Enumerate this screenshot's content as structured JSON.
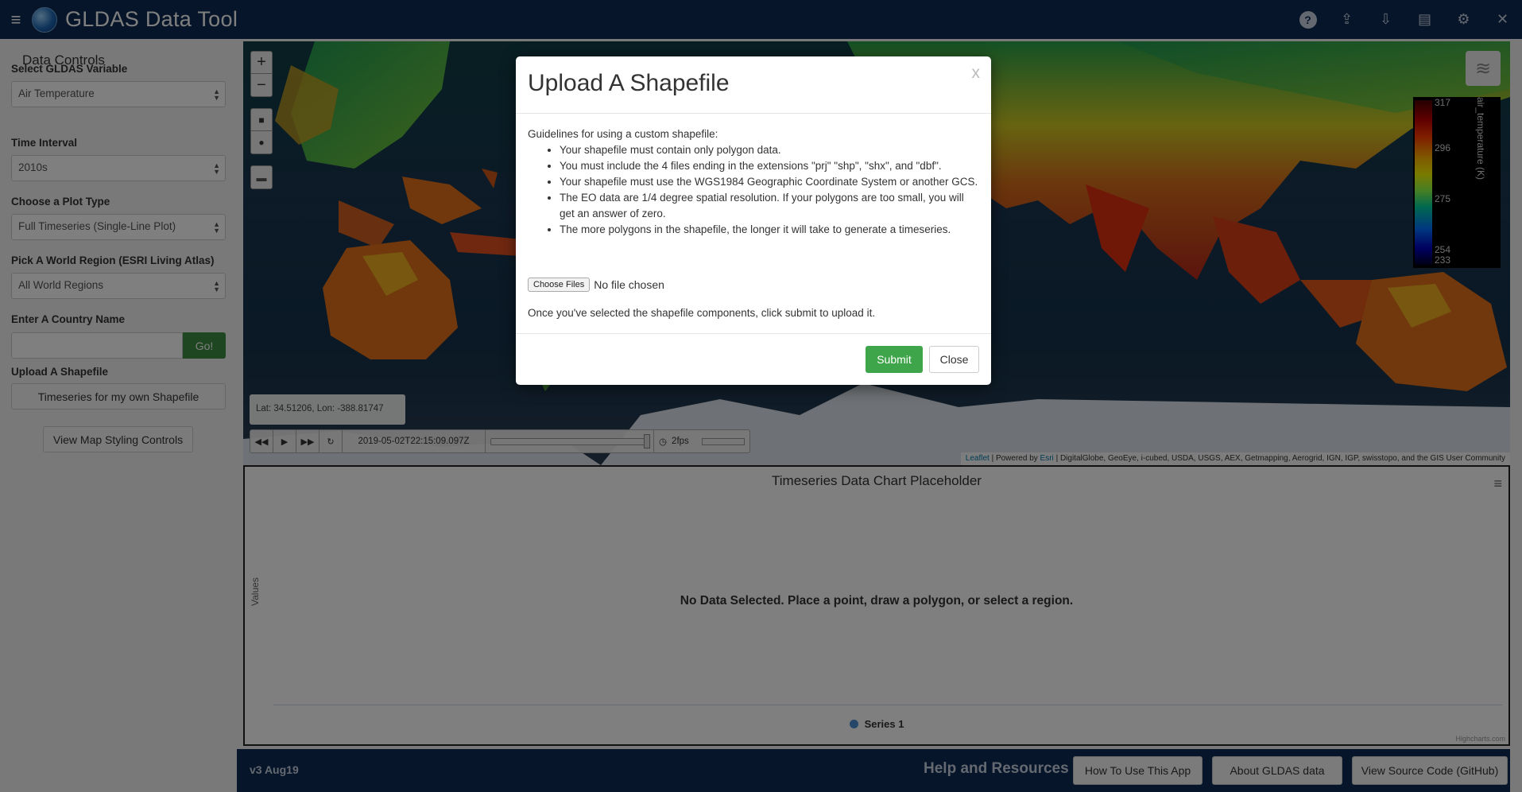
{
  "header": {
    "title": "GLDAS Data Tool",
    "menu_icon": "hamburger-icon",
    "tools": [
      {
        "icon": "help-icon",
        "glyph": "?"
      },
      {
        "icon": "upload-icon",
        "glyph": "⇪"
      },
      {
        "icon": "download-icon",
        "glyph": "⇩"
      },
      {
        "icon": "layers-stack-icon",
        "glyph": "▤"
      },
      {
        "icon": "gear-icon",
        "glyph": "⚙"
      },
      {
        "icon": "close-icon",
        "glyph": "✕"
      }
    ],
    "colors": {
      "background": "#0c2a52",
      "text": "#ffffff"
    }
  },
  "sidebar": {
    "title": "Data Controls",
    "variable": {
      "label": "Select GLDAS Variable",
      "value": "Air Temperature"
    },
    "interval": {
      "label": "Time Interval",
      "value": "2010s"
    },
    "plot_type": {
      "label": "Choose a Plot Type",
      "value": "Full Timeseries (Single-Line Plot)"
    },
    "region": {
      "label": "Pick A World Region (ESRI Living Atlas)",
      "value": "All World Regions"
    },
    "country": {
      "label": "Enter A Country Name",
      "value": "",
      "go_label": "Go!"
    },
    "shapefile": {
      "label": "Upload A Shapefile",
      "button": "Timeseries for my own Shapefile"
    },
    "styling_button": "View Map Styling Controls"
  },
  "map": {
    "zoom_in": "+",
    "zoom_out": "−",
    "legend": {
      "variable": "air_temperature (K)",
      "ticks": [
        "317",
        "296",
        "275",
        "254",
        "233"
      ]
    },
    "coordinates": "Lat: 34.51206, Lon: -388.81747",
    "time": "2019-05-02T22:15:09.097Z",
    "fps": "2fps",
    "attribution": {
      "leaflet": "Leaflet",
      "powered": "| Powered by",
      "esri": "Esri",
      "rest": "| DigitalGlobe, GeoEye, i-cubed, USDA, USGS, AEX, Getmapping, Aerogrid, IGN, IGP, swisstopo, and the GIS User Community"
    }
  },
  "chart": {
    "title": "Timeseries Data Chart Placeholder",
    "ylabel": "Values",
    "no_data": "No Data Selected. Place a point, draw a polygon, or select a region.",
    "legend": "Series 1",
    "credits": "Highcharts.com"
  },
  "footer": {
    "version": "v3 Aug19",
    "help_title": "Help and Resources",
    "buttons": [
      "How To Use This App",
      "About GLDAS data",
      "View Source Code (GitHub)"
    ]
  },
  "modal": {
    "title": "Upload A Shapefile",
    "close_x": "x",
    "intro": "Guidelines for using a custom shapefile:",
    "guidelines": [
      "Your shapefile must contain only polygon data.",
      "You must include the 4 files ending in the extensions \"prj\" \"shp\", \"shx\", and \"dbf\".",
      "Your shapefile must use the WGS1984 Geographic Coordinate System or another GCS.",
      "The EO data are 1/4 degree spatial resolution. If your polygons are too small, you will get an answer of zero.",
      "The more polygons in the shapefile, the longer it will take to generate a timeseries."
    ],
    "choose_files": "Choose Files",
    "no_file": "No file chosen",
    "help": "Once you've selected the shapefile components, click submit to upload it.",
    "submit": "Submit",
    "close": "Close"
  }
}
